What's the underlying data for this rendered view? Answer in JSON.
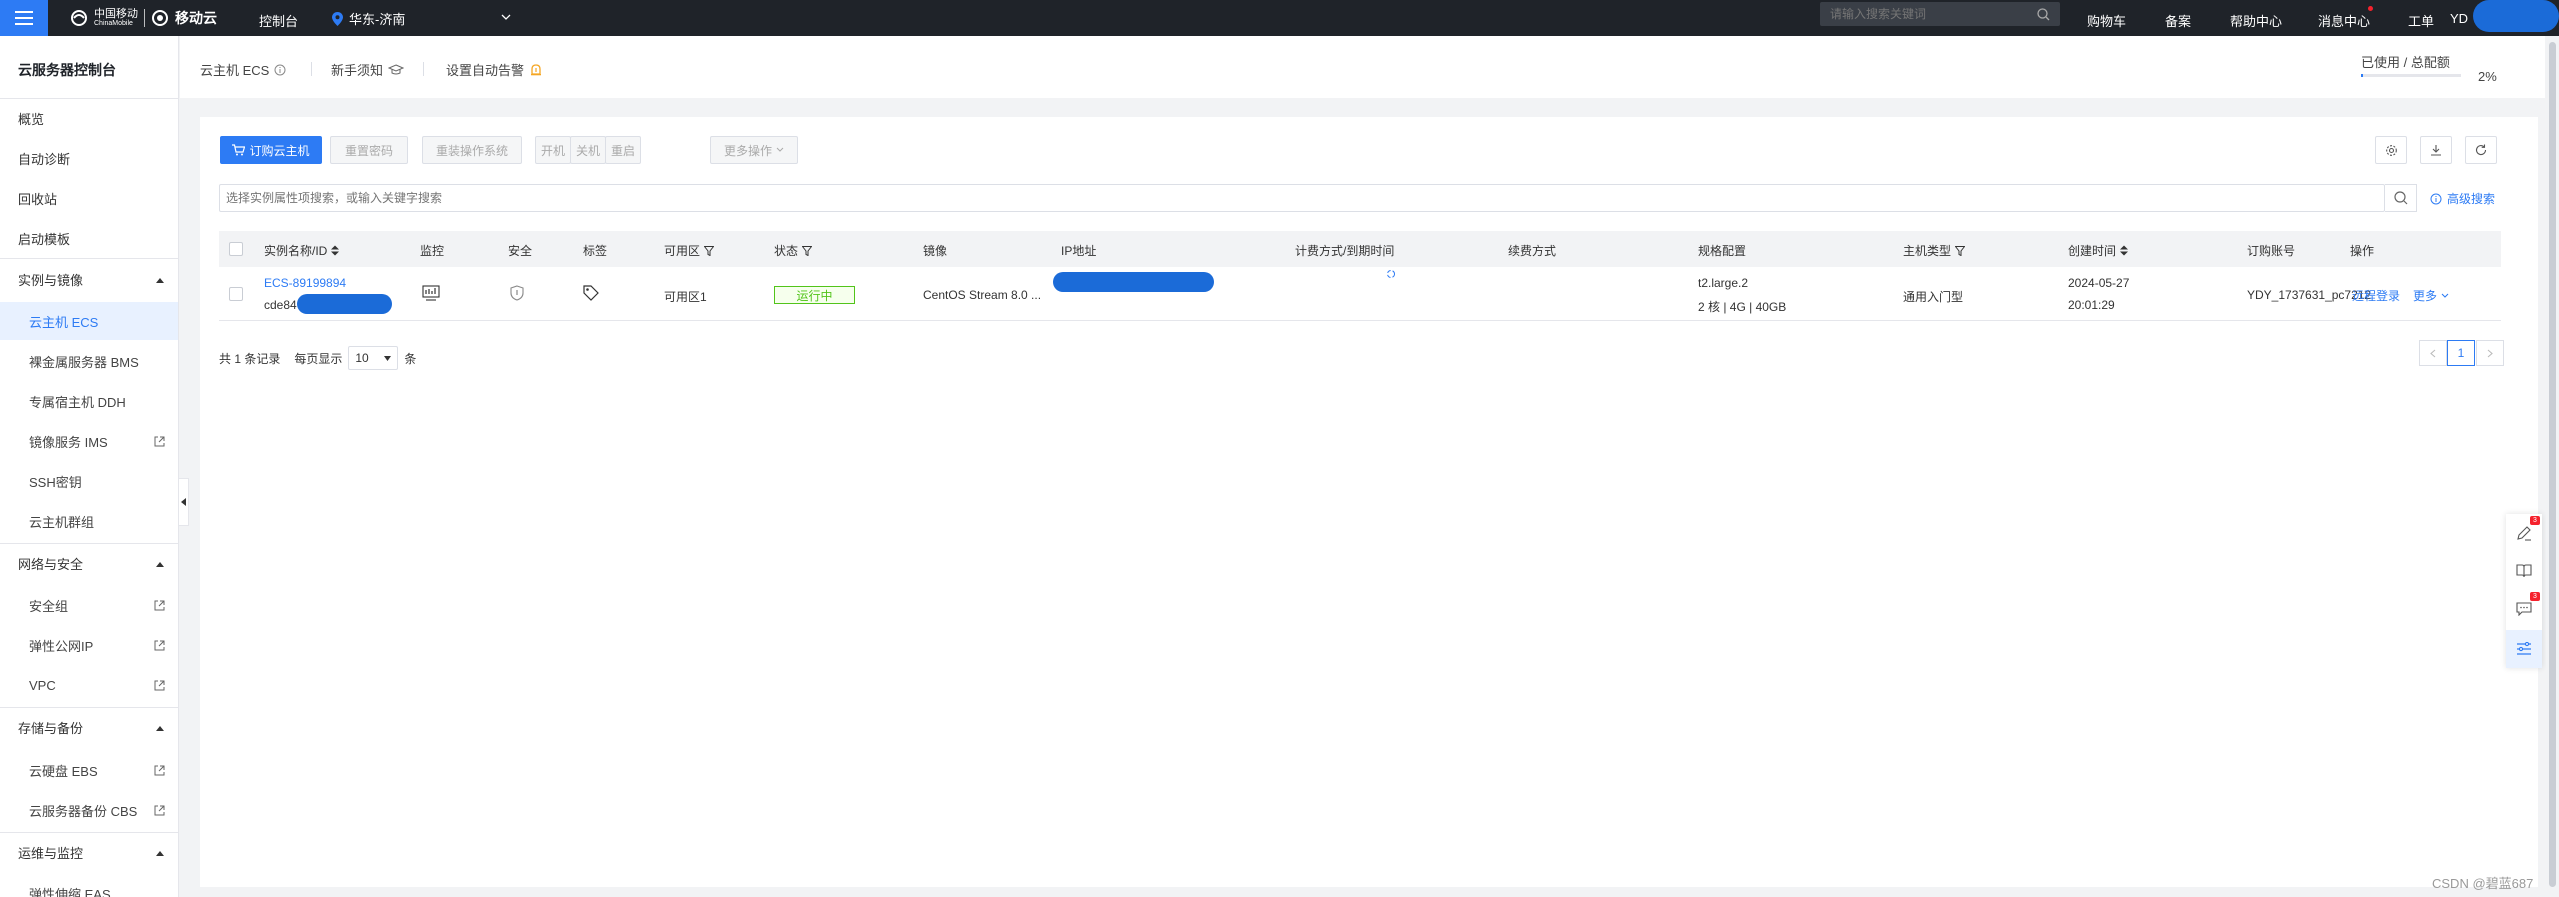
{
  "topbar": {
    "logo_cn": "中国移动",
    "logo_en": "ChinaMobile",
    "logo_cloud": "移动云",
    "console": "控制台",
    "region": "华东-济南",
    "search_placeholder": "请输入搜索关键词",
    "links": [
      "购物车",
      "备案",
      "帮助中心",
      "消息中心",
      "工单"
    ],
    "user": "YD"
  },
  "sidebar": {
    "title": "云服务器控制台",
    "top_items": [
      "概览",
      "自动诊断",
      "回收站",
      "启动模板"
    ],
    "groups": [
      {
        "label": "实例与镜像",
        "items": [
          "云主机 ECS",
          "裸金属服务器 BMS",
          "专属宿主机 DDH",
          "镜像服务 IMS",
          "SSH密钥",
          "云主机群组"
        ]
      },
      {
        "label": "网络与安全",
        "items": [
          "安全组",
          "弹性公网IP",
          "VPC"
        ]
      },
      {
        "label": "存储与备份",
        "items": [
          "云硬盘 EBS",
          "云服务器备份 CBS"
        ]
      },
      {
        "label": "运维与监控",
        "items": [
          "弹性伸缩 EAS"
        ]
      }
    ]
  },
  "header": {
    "page": "云主机 ECS",
    "guide": "新手须知",
    "alarm": "设置自动告警",
    "quota_label": "已使用 / 总配额",
    "quota_pct": "2%",
    "quota_value": 0.02
  },
  "toolbar": {
    "order": "订购云主机",
    "reset_pwd": "重置密码",
    "reinstall": "重装操作系统",
    "start": "开机",
    "stop": "关机",
    "restart": "重启",
    "more": "更多操作"
  },
  "filter": {
    "placeholder": "选择实例属性项搜索，或输入关键字搜索",
    "advanced": "高级搜索"
  },
  "table": {
    "columns": [
      "实例名称/ID",
      "监控",
      "安全",
      "标签",
      "可用区",
      "状态",
      "镜像",
      "IP地址",
      "计费方式/到期时间",
      "续费方式",
      "规格配置",
      "主机类型",
      "创建时间",
      "订购账号",
      "操作"
    ],
    "rows": [
      {
        "name": "ECS-89199894",
        "id": "cde84",
        "zone": "可用区1",
        "status": "运行中",
        "image": "CentOS Stream 8.0 ...",
        "spec_line1": "t2.large.2",
        "spec_line2": "2 核 | 4G | 40GB",
        "host_type": "通用入门型",
        "created_date": "2024-05-27",
        "created_time": "20:01:29",
        "account": "YDY_1737631_pc7212",
        "op_login": "远程登录",
        "op_more": "更多"
      }
    ]
  },
  "pager": {
    "total_prefix": "共 1 条记录",
    "per_page_label": "每页显示",
    "per_page": "10",
    "unit": "条",
    "current": "1"
  },
  "float_tools": {
    "badge1": "3",
    "badge2": "3"
  },
  "watermark": "CSDN @碧蓝687"
}
